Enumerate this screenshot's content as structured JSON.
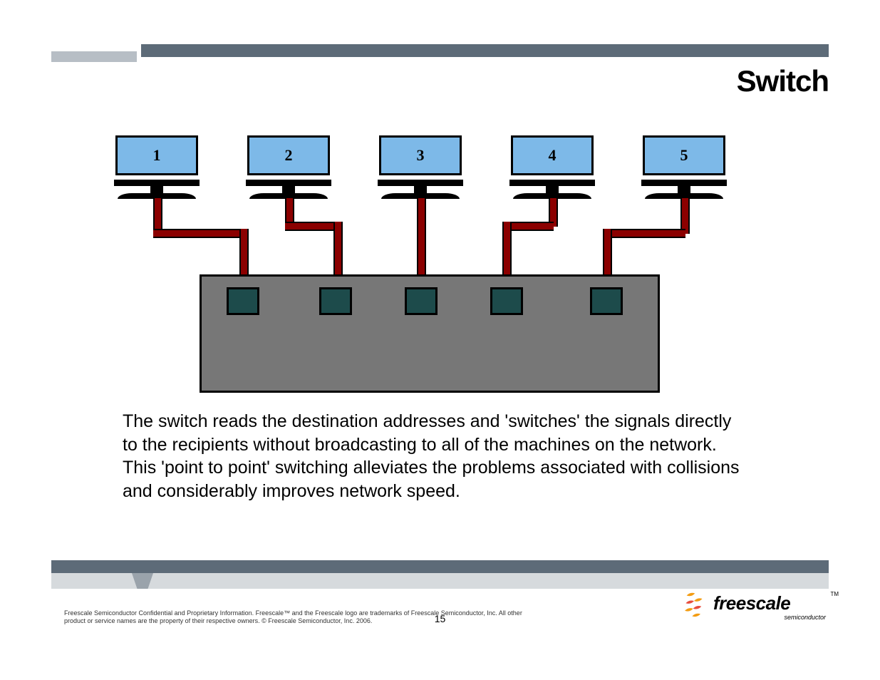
{
  "header": {
    "title": "Switch"
  },
  "diagram": {
    "monitors": [
      "1",
      "2",
      "3",
      "4",
      "5"
    ],
    "port_count": 5
  },
  "body": {
    "para1": "The switch reads the destination addresses and 'switches' the signals directly to the recipients without broadcasting to all of the machines on the network.",
    "para2": "This 'point to point' switching alleviates the problems associated with collisions and considerably improves network speed."
  },
  "footer": {
    "legal": "Freescale Semiconductor Confidential and Proprietary Information. Freescale™ and the Freescale logo are trademarks of Freescale Semiconductor, Inc. All other product or service names are the property of their respective owners. © Freescale Semiconductor, Inc. 2006.",
    "page_number": "15",
    "logo_brand": "freescale",
    "logo_sub": "semiconductor",
    "logo_tm": "TM"
  }
}
